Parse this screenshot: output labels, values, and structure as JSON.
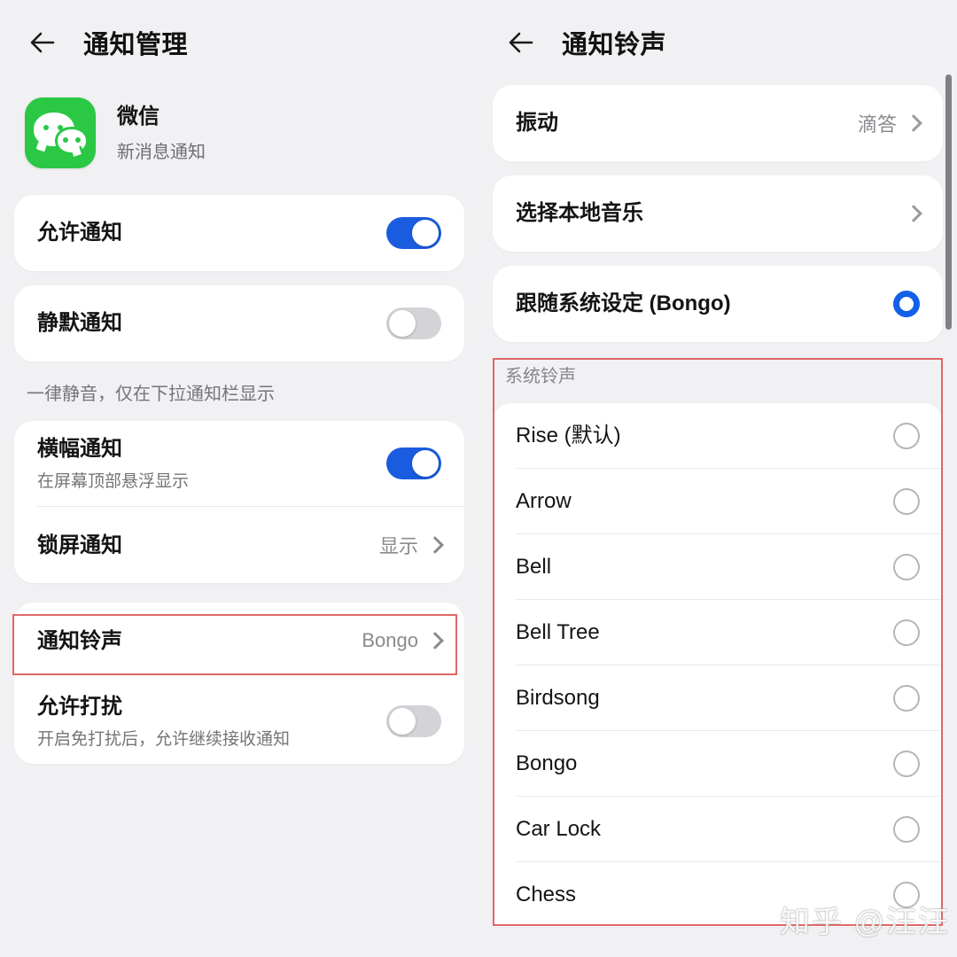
{
  "left_panel": {
    "header": {
      "back_icon": "back-arrow-icon",
      "title": "通知管理"
    },
    "app": {
      "icon": "wechat-icon",
      "name": "微信",
      "subtitle": "新消息通知"
    },
    "rows": {
      "allow_notifications": {
        "title": "允许通知",
        "toggle": "on"
      },
      "silent_notifications": {
        "title": "静默通知",
        "toggle": "off"
      },
      "silent_hint": "一律静音，仅在下拉通知栏显示",
      "banner_notifications": {
        "title": "横幅通知",
        "subtitle": "在屏幕顶部悬浮显示",
        "toggle": "on"
      },
      "lockscreen_notifications": {
        "title": "锁屏通知",
        "value": "显示",
        "chevron": "chevron-right-icon"
      },
      "notification_ringtone": {
        "title": "通知铃声",
        "value": "Bongo",
        "chevron": "chevron-right-icon",
        "highlighted": true
      },
      "allow_interrupt": {
        "title": "允许打扰",
        "subtitle": "开启免打扰后，允许继续接收通知",
        "toggle": "off"
      }
    }
  },
  "right_panel": {
    "header": {
      "back_icon": "back-arrow-icon",
      "title": "通知铃声"
    },
    "vibration": {
      "title": "振动",
      "value": "滴答",
      "chevron": "chevron-right-icon"
    },
    "local_music": {
      "title": "选择本地音乐",
      "chevron": "chevron-right-icon"
    },
    "follow_system": {
      "title": "跟随系统设定 (Bongo)",
      "selected": true
    },
    "section_label": "系统铃声",
    "ringtones": [
      {
        "name": "Rise (默认)",
        "selected": false
      },
      {
        "name": "Arrow",
        "selected": false
      },
      {
        "name": "Bell",
        "selected": false
      },
      {
        "name": "Bell Tree",
        "selected": false
      },
      {
        "name": "Birdsong",
        "selected": false
      },
      {
        "name": "Bongo",
        "selected": false
      },
      {
        "name": "Car Lock",
        "selected": false
      },
      {
        "name": "Chess",
        "selected": false
      }
    ]
  },
  "watermark": "知乎 @汪汪",
  "colors": {
    "accent_blue": "#1a5ce0",
    "radio_blue": "#1260e8",
    "wechat_green": "#2ac845",
    "background": "#f1f1f3",
    "card": "#ffffff",
    "highlight_red": "#e06666"
  }
}
